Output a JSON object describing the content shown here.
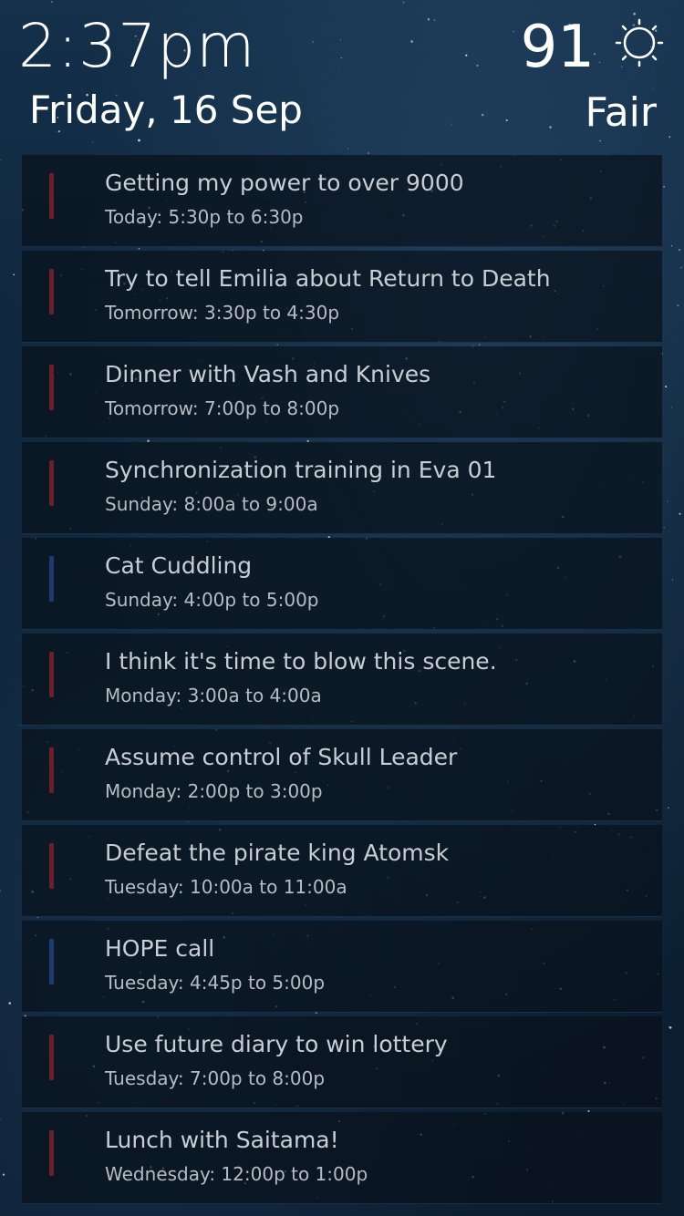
{
  "header": {
    "time": "2:37pm",
    "date": "Friday, 16 Sep",
    "temperature": "91",
    "condition": "Fair",
    "weather_icon": "sun-icon"
  },
  "colors": {
    "red_bar": "#6a1f2a",
    "blue_bar": "#1f3a70"
  },
  "events": [
    {
      "title": "Getting my power to over 9000",
      "time": "Today: 5:30p to 6:30p",
      "color": "red"
    },
    {
      "title": "Try to tell Emilia about Return to Death",
      "time": "Tomorrow: 3:30p to 4:30p",
      "color": "red"
    },
    {
      "title": "Dinner with Vash and Knives",
      "time": "Tomorrow: 7:00p to 8:00p",
      "color": "red"
    },
    {
      "title": "Synchronization training in Eva 01",
      "time": "Sunday: 8:00a to 9:00a",
      "color": "red"
    },
    {
      "title": "Cat Cuddling",
      "time": "Sunday: 4:00p to 5:00p",
      "color": "blue"
    },
    {
      "title": "I think it's time to blow this scene.",
      "time": "Monday: 3:00a to 4:00a",
      "color": "red"
    },
    {
      "title": "Assume control of Skull Leader",
      "time": "Monday: 2:00p to 3:00p",
      "color": "red"
    },
    {
      "title": "Defeat the pirate king Atomsk",
      "time": "Tuesday: 10:00a to 11:00a",
      "color": "red"
    },
    {
      "title": "HOPE call",
      "time": "Tuesday: 4:45p to 5:00p",
      "color": "blue"
    },
    {
      "title": "Use future diary to win lottery",
      "time": "Tuesday: 7:00p to 8:00p",
      "color": "red"
    },
    {
      "title": "Lunch with Saitama!",
      "time": "Wednesday: 12:00p to 1:00p",
      "color": "red"
    }
  ]
}
